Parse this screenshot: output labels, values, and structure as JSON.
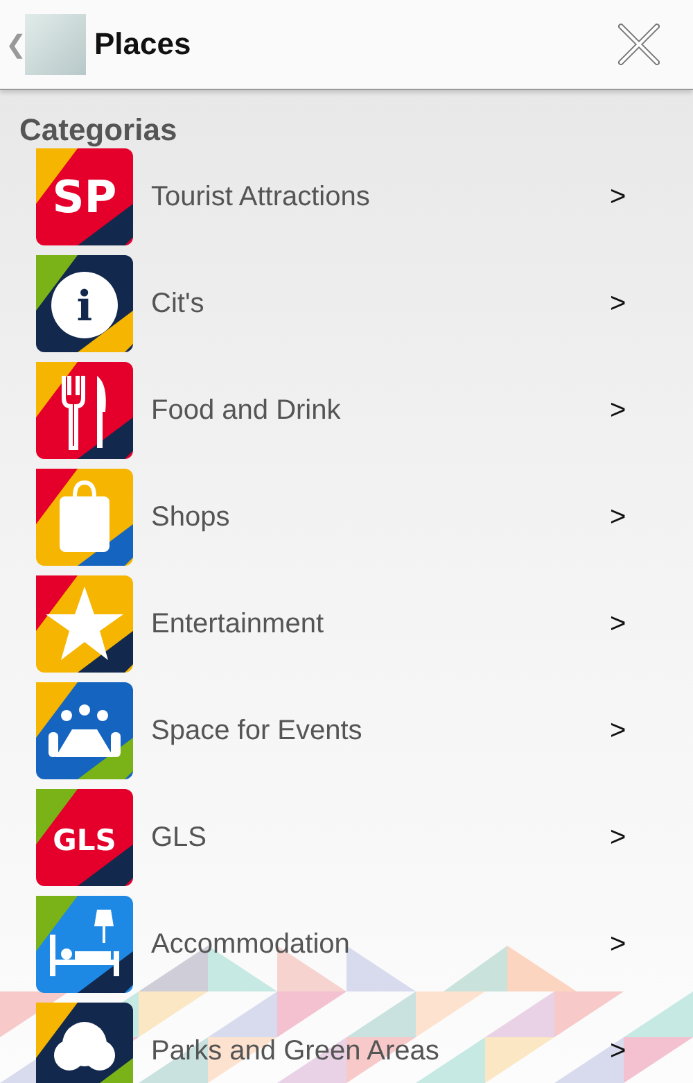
{
  "header": {
    "back": "❮",
    "title": "Places"
  },
  "section_title": "Categorias",
  "categories": [
    {
      "label": "Tourist Attractions",
      "kind": "sp",
      "icon_text": "SP",
      "arrow": ">"
    },
    {
      "label": "Cit's",
      "kind": "info",
      "icon_text": "i",
      "arrow": ">"
    },
    {
      "label": "Food and Drink",
      "kind": "food",
      "arrow": ">"
    },
    {
      "label": "Shops",
      "kind": "shop",
      "arrow": ">"
    },
    {
      "label": "Entertainment",
      "kind": "star",
      "arrow": ">"
    },
    {
      "label": "Space for Events",
      "kind": "meeting",
      "arrow": ">"
    },
    {
      "label": "GLS",
      "kind": "gls",
      "icon_text": "GLS",
      "arrow": ">"
    },
    {
      "label": "Accommodation",
      "kind": "bed",
      "arrow": ">"
    },
    {
      "label": "Parks and Green Areas",
      "kind": "tree",
      "arrow": ">"
    }
  ]
}
